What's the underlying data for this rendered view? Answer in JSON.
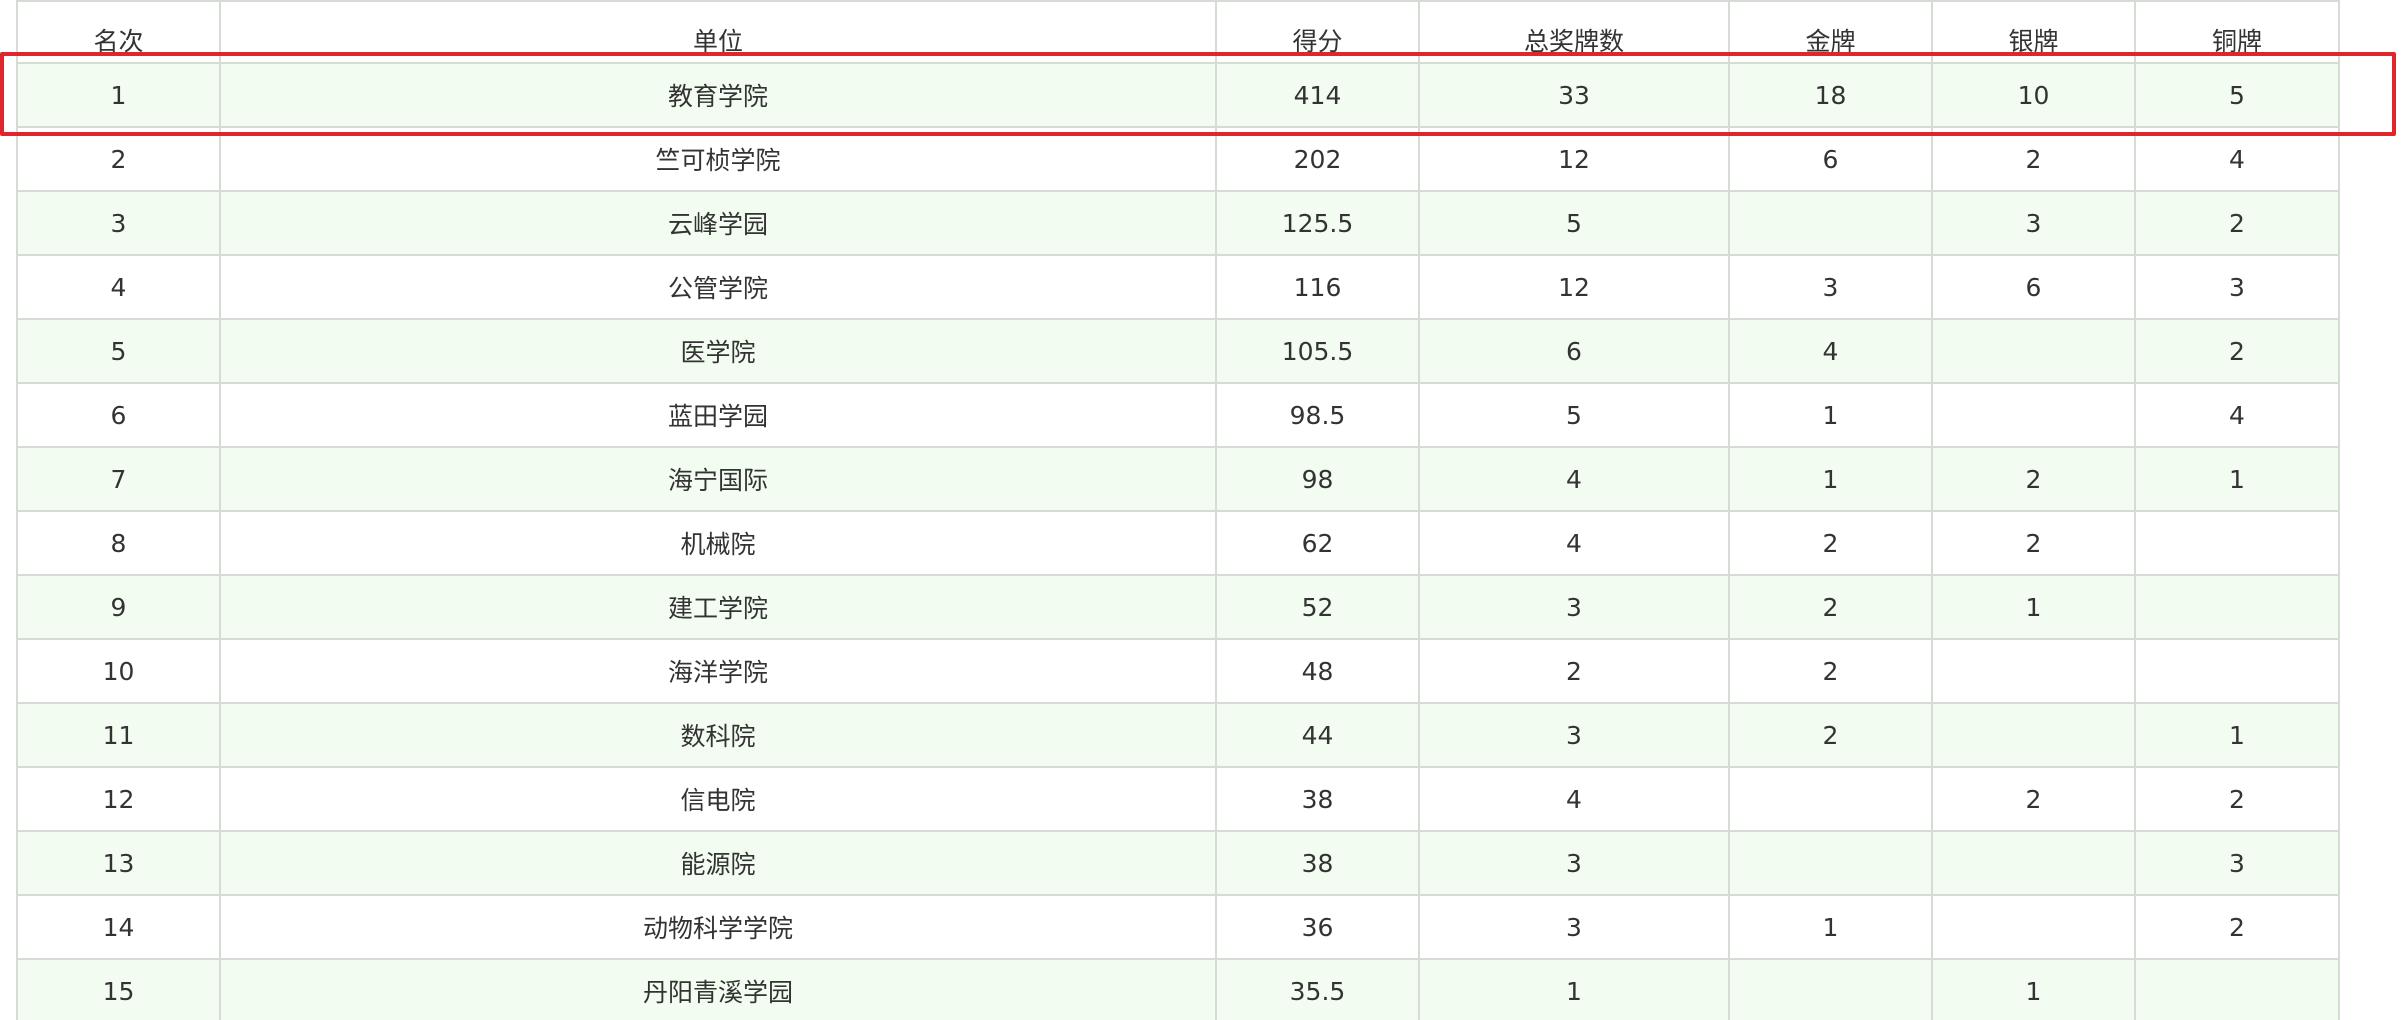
{
  "table": {
    "columns": [
      "名次",
      "单位",
      "得分",
      "总奖牌数",
      "金牌",
      "银牌",
      "铜牌"
    ],
    "rows": [
      [
        "1",
        "教育学院",
        "414",
        "33",
        "18",
        "10",
        "5"
      ],
      [
        "2",
        "竺可桢学院",
        "202",
        "12",
        "6",
        "2",
        "4"
      ],
      [
        "3",
        "云峰学园",
        "125.5",
        "5",
        "",
        "3",
        "2"
      ],
      [
        "4",
        "公管学院",
        "116",
        "12",
        "3",
        "6",
        "3"
      ],
      [
        "5",
        "医学院",
        "105.5",
        "6",
        "4",
        "",
        "2"
      ],
      [
        "6",
        "蓝田学园",
        "98.5",
        "5",
        "1",
        "",
        "4"
      ],
      [
        "7",
        "海宁国际",
        "98",
        "4",
        "1",
        "2",
        "1"
      ],
      [
        "8",
        "机械院",
        "62",
        "4",
        "2",
        "2",
        ""
      ],
      [
        "9",
        "建工学院",
        "52",
        "3",
        "2",
        "1",
        ""
      ],
      [
        "10",
        "海洋学院",
        "48",
        "2",
        "2",
        "",
        ""
      ],
      [
        "11",
        "数科院",
        "44",
        "3",
        "2",
        "",
        "1"
      ],
      [
        "12",
        "信电院",
        "38",
        "4",
        "",
        "2",
        "2"
      ],
      [
        "13",
        "能源院",
        "38",
        "3",
        "",
        "",
        "3"
      ],
      [
        "14",
        "动物科学学院",
        "36",
        "3",
        "1",
        "",
        "2"
      ],
      [
        "15",
        "丹阳青溪学园",
        "35.5",
        "1",
        "",
        "1",
        ""
      ]
    ]
  },
  "colors": {
    "row_alt": "#f2fcf0",
    "border": "#d4dcd4",
    "highlight": "#e0262a"
  }
}
